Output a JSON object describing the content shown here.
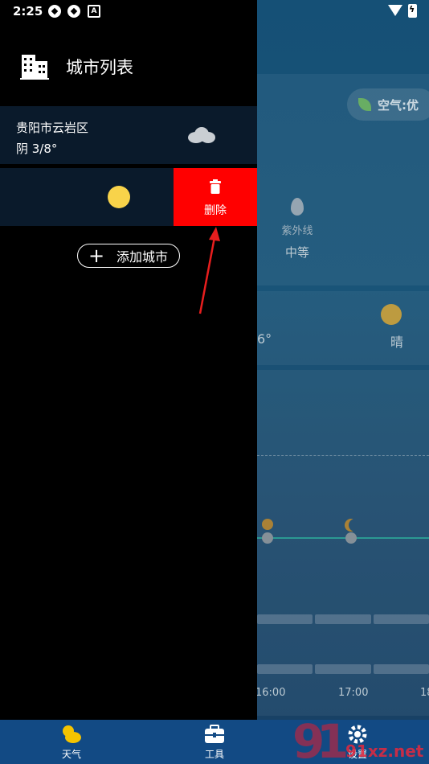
{
  "status_bar": {
    "time": "2:25"
  },
  "background": {
    "air_quality": "空气:优",
    "uv_label": "紫外线",
    "uv_value": "中等",
    "weather_condition": "晴",
    "temp_fragment": "6°",
    "times": [
      "16:00",
      "17:00",
      "18"
    ]
  },
  "drawer": {
    "title": "城市列表",
    "cities": [
      {
        "name": "贵阳市云岩区",
        "temperature": "阴  3/8°",
        "icon": "cloud-icon"
      },
      {
        "name": "",
        "temperature": "",
        "icon": "sun-icon"
      }
    ],
    "delete_label": "删除",
    "add_city_label": "添加城市"
  },
  "bottom_nav": {
    "items": [
      {
        "label": "天气",
        "icon": "weather-icon"
      },
      {
        "label": "工具",
        "icon": "toolbox-icon"
      },
      {
        "label": "设置",
        "icon": "settings-icon"
      }
    ]
  },
  "watermark": "91xz.net",
  "colors": {
    "delete": "#ff0000",
    "nav": "#124a84",
    "row": "#0a1a2b",
    "sun": "#f8d34a",
    "arrow": "#e81e1e"
  }
}
